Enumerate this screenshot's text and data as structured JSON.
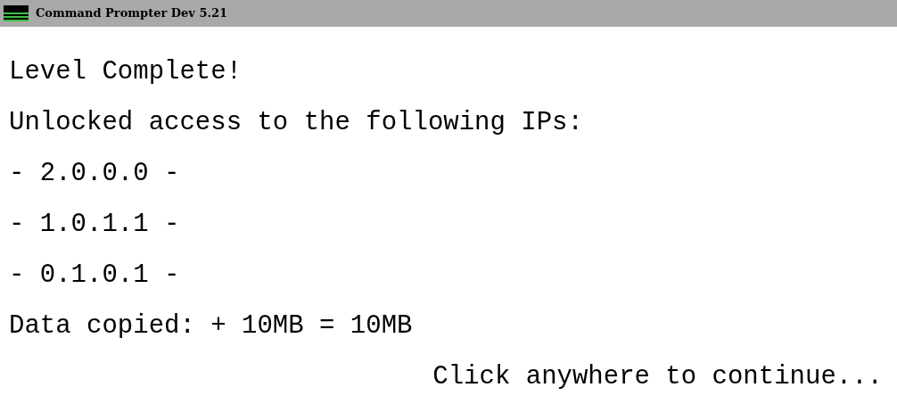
{
  "window": {
    "title": "Command Prompter Dev 5.21"
  },
  "lines": [
    "Level Complete!",
    "Unlocked access to the following IPs:",
    "- 2.0.0.0 -",
    "- 1.0.1.1 -",
    "- 0.1.0.1 -",
    "Data copied: + 10MB = 10MB"
  ],
  "prompt": "Click anywhere to continue..."
}
